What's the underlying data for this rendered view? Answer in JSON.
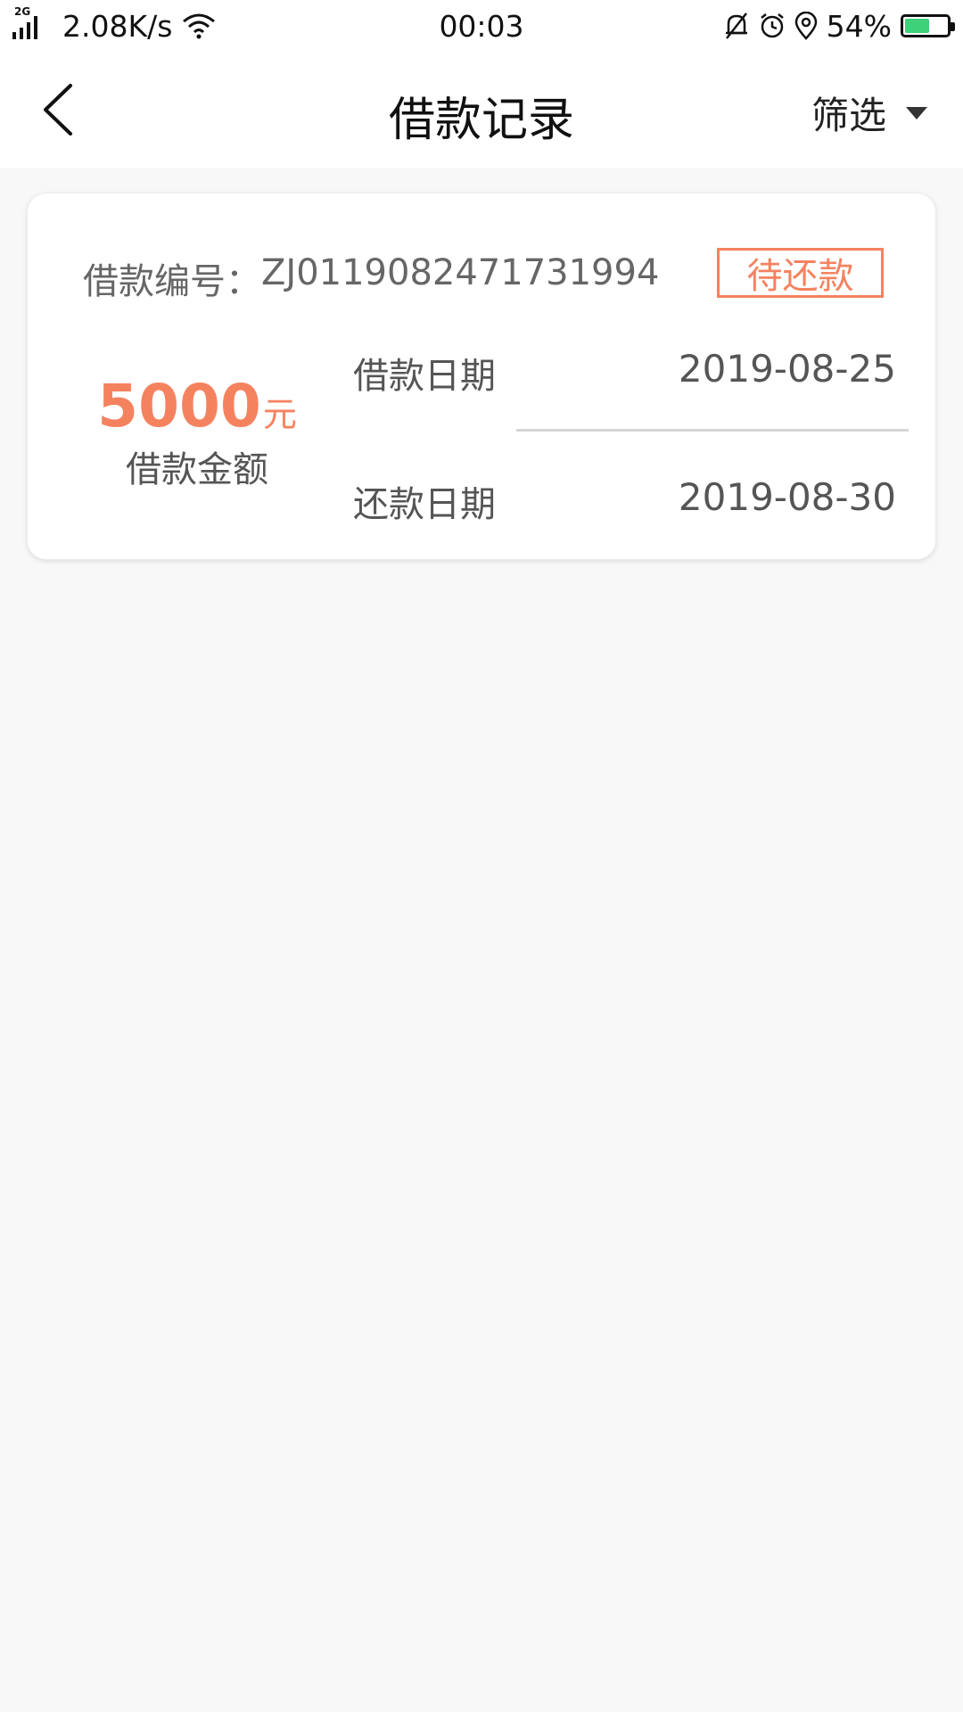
{
  "status_bar": {
    "network": "2G",
    "speed": "2.08K/s",
    "time": "00:03",
    "battery": "54%"
  },
  "header": {
    "title": "借款记录",
    "filter_label": "筛选"
  },
  "record": {
    "loan_no_label": "借款编号：",
    "loan_no": "ZJ0119082471731994",
    "status": "待还款",
    "amount": "5000",
    "amount_unit": "元",
    "amount_label": "借款金额",
    "loan_date_label": "借款日期",
    "loan_date": "2019-08-25",
    "repay_date_label": "还款日期",
    "repay_date": "2019-08-30"
  },
  "colors": {
    "accent": "#f5825f",
    "background": "#f8f8f8"
  }
}
